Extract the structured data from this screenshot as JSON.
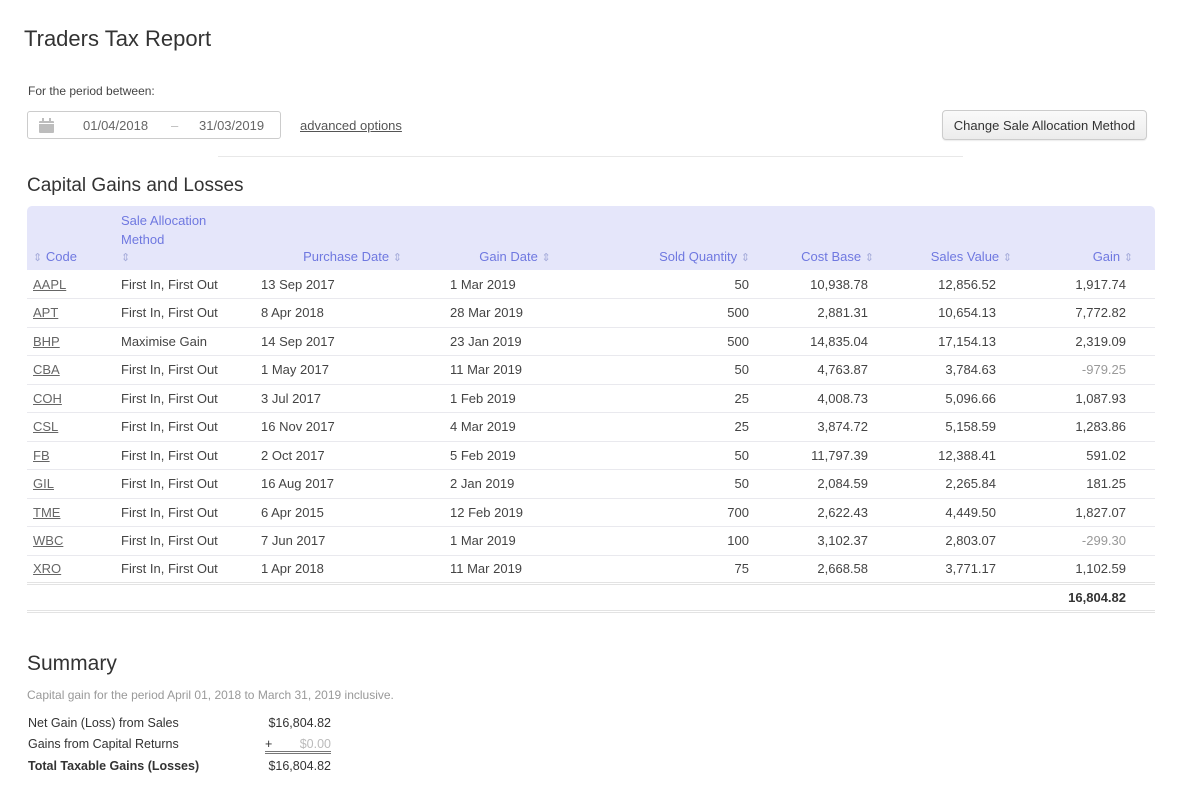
{
  "header": {
    "title": "Traders Tax Report",
    "period_label": "For the period between:",
    "date_from": "01/04/2018",
    "date_separator": "–",
    "date_to": "31/03/2019",
    "advanced_options": "advanced options",
    "change_button": "Change Sale Allocation Method"
  },
  "gains": {
    "title": "Capital Gains and Losses",
    "sort_icon": "⇕",
    "columns": [
      {
        "label": "Code"
      },
      {
        "label": "Sale Allocation Method"
      },
      {
        "label": "Purchase Date"
      },
      {
        "label": "Gain Date"
      },
      {
        "label": "Sold Quantity"
      },
      {
        "label": "Cost Base"
      },
      {
        "label": "Sales Value"
      },
      {
        "label": "Gain"
      }
    ],
    "rows": [
      {
        "code": "AAPL",
        "method": "First In, First Out",
        "purchase": "13 Sep 2017",
        "gain_date": "1 Mar 2019",
        "qty": "50",
        "cost": "10,938.78",
        "sales": "12,856.52",
        "gain": "1,917.74",
        "negative": false
      },
      {
        "code": "APT",
        "method": "First In, First Out",
        "purchase": "8 Apr 2018",
        "gain_date": "28 Mar 2019",
        "qty": "500",
        "cost": "2,881.31",
        "sales": "10,654.13",
        "gain": "7,772.82",
        "negative": false
      },
      {
        "code": "BHP",
        "method": "Maximise Gain",
        "purchase": "14 Sep 2017",
        "gain_date": "23 Jan 2019",
        "qty": "500",
        "cost": "14,835.04",
        "sales": "17,154.13",
        "gain": "2,319.09",
        "negative": false
      },
      {
        "code": "CBA",
        "method": "First In, First Out",
        "purchase": "1 May 2017",
        "gain_date": "11 Mar 2019",
        "qty": "50",
        "cost": "4,763.87",
        "sales": "3,784.63",
        "gain": "-979.25",
        "negative": true
      },
      {
        "code": "COH",
        "method": "First In, First Out",
        "purchase": "3 Jul 2017",
        "gain_date": "1 Feb 2019",
        "qty": "25",
        "cost": "4,008.73",
        "sales": "5,096.66",
        "gain": "1,087.93",
        "negative": false
      },
      {
        "code": "CSL",
        "method": "First In, First Out",
        "purchase": "16 Nov 2017",
        "gain_date": "4 Mar 2019",
        "qty": "25",
        "cost": "3,874.72",
        "sales": "5,158.59",
        "gain": "1,283.86",
        "negative": false
      },
      {
        "code": "FB",
        "method": "First In, First Out",
        "purchase": "2 Oct 2017",
        "gain_date": "5 Feb 2019",
        "qty": "50",
        "cost": "11,797.39",
        "sales": "12,388.41",
        "gain": "591.02",
        "negative": false
      },
      {
        "code": "GIL",
        "method": "First In, First Out",
        "purchase": "16 Aug 2017",
        "gain_date": "2 Jan 2019",
        "qty": "50",
        "cost": "2,084.59",
        "sales": "2,265.84",
        "gain": "181.25",
        "negative": false
      },
      {
        "code": "TME",
        "method": "First In, First Out",
        "purchase": "6 Apr 2015",
        "gain_date": "12 Feb 2019",
        "qty": "700",
        "cost": "2,622.43",
        "sales": "4,449.50",
        "gain": "1,827.07",
        "negative": false
      },
      {
        "code": "WBC",
        "method": "First In, First Out",
        "purchase": "7 Jun 2017",
        "gain_date": "1 Mar 2019",
        "qty": "100",
        "cost": "3,102.37",
        "sales": "2,803.07",
        "gain": "-299.30",
        "negative": true
      },
      {
        "code": "XRO",
        "method": "First In, First Out",
        "purchase": "1 Apr 2018",
        "gain_date": "11 Mar 2019",
        "qty": "75",
        "cost": "2,668.58",
        "sales": "3,771.17",
        "gain": "1,102.59",
        "negative": false
      }
    ],
    "total": "16,804.82"
  },
  "summary": {
    "title": "Summary",
    "note": "Capital gain for the period April 01, 2018 to March 31, 2019 inclusive.",
    "net_label": "Net Gain (Loss) from Sales",
    "net_value": "$16,804.82",
    "returns_label": "Gains from Capital Returns",
    "returns_plus": "+",
    "returns_value": "$0.00",
    "total_label": "Total Taxable Gains (Losses)",
    "total_value": "$16,804.82"
  }
}
